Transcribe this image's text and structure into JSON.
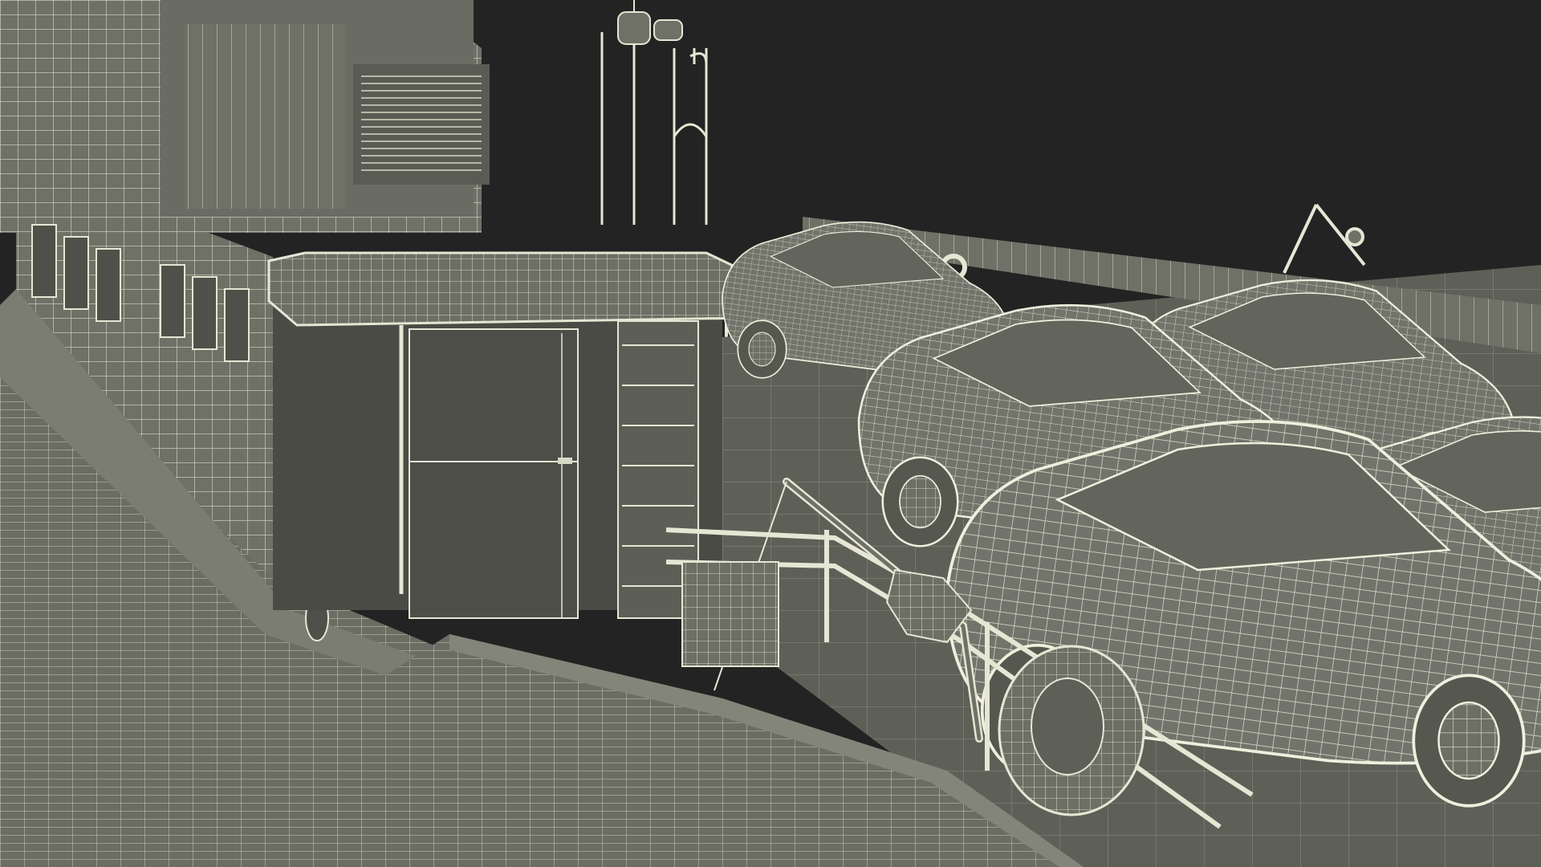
{
  "scene": {
    "subject": "wireframe-render",
    "background_color": "#232323",
    "model_fill_color": "#6f7066",
    "model_dark_fill_color": "#4f5049",
    "model_light_fill_color": "#8a8b80",
    "wire_color": "#e8e8d8"
  }
}
